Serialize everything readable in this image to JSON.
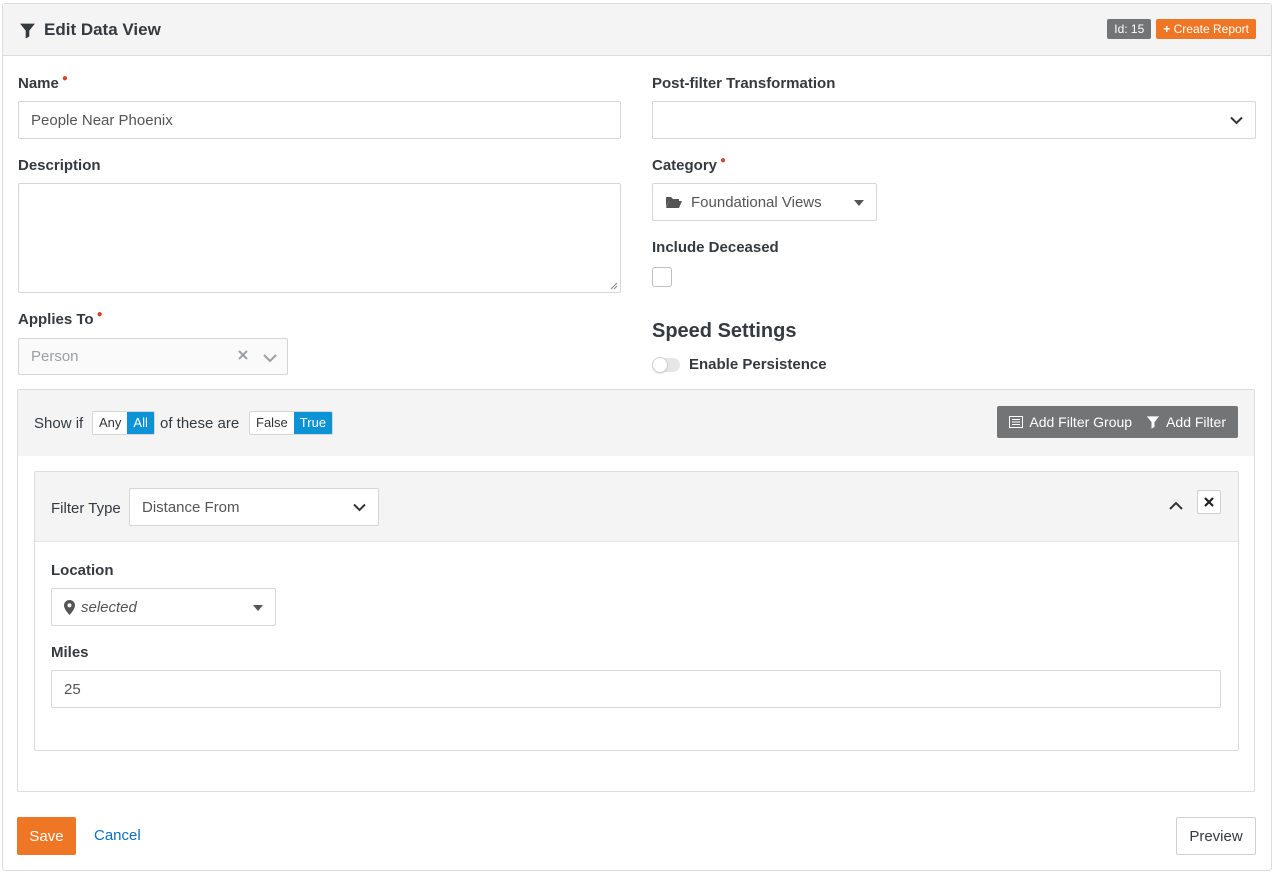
{
  "header": {
    "title": "Edit Data View",
    "id_badge": "Id: 15",
    "create_report_label": "Create Report",
    "icons": [
      "filter-icon",
      "plus-icon"
    ]
  },
  "form": {
    "name_label": "Name",
    "name_value": "People Near Phoenix",
    "description_label": "Description",
    "description_value": "",
    "applies_to_label": "Applies To",
    "applies_to_value": "Person",
    "post_filter_label": "Post-filter Transformation",
    "post_filter_value": "",
    "category_label": "Category",
    "category_value": "Foundational Views",
    "include_deceased_label": "Include Deceased",
    "include_deceased_checked": false,
    "speed_settings_title": "Speed Settings",
    "enable_persistence_label": "Enable Persistence",
    "enable_persistence_on": false
  },
  "filters": {
    "show_if_label": "Show if",
    "any_label": "Any",
    "all_label": "All",
    "selected_match": "All",
    "of_these_are_label": "of these are",
    "false_label": "False",
    "true_label": "True",
    "selected_truth": "True",
    "add_filter_group_label": "Add Filter Group",
    "add_filter_label": "Add Filter",
    "filter": {
      "type_label": "Filter Type",
      "type_value": "Distance From",
      "location_label": "Location",
      "location_value": "selected",
      "miles_label": "Miles",
      "miles_value": "25"
    }
  },
  "footer": {
    "save_label": "Save",
    "cancel_label": "Cancel",
    "preview_label": "Preview"
  },
  "colors": {
    "accent_orange": "#ee7625",
    "accent_blue": "#0b93d5",
    "button_gray": "#737475",
    "required_red": "#d4442e",
    "link_blue": "#0b6fc0"
  }
}
